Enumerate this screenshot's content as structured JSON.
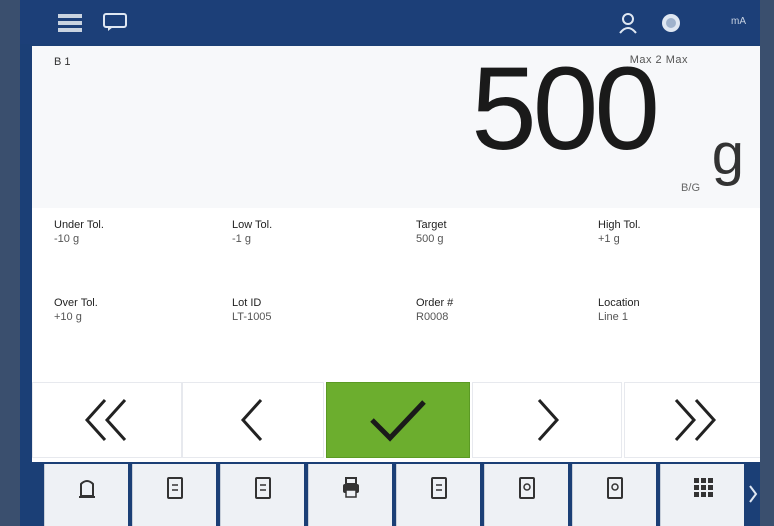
{
  "topbar": {
    "status_text": "mA"
  },
  "weigh": {
    "scale_id": "B 1",
    "scale_info": "Max 2 Max",
    "weight": "500",
    "unit": "g",
    "sub_label": "B/G"
  },
  "fields": [
    {
      "label": "Under Tol.",
      "value": "-10 g"
    },
    {
      "label": "Low Tol.",
      "value": "-1 g"
    },
    {
      "label": "Target",
      "value": "500 g"
    },
    {
      "label": "High Tol.",
      "value": "+1 g"
    },
    {
      "label": "Over Tol.",
      "value": "+10 g"
    },
    {
      "label": "Lot ID",
      "value": "LT-1005"
    },
    {
      "label": "Order #",
      "value": "R0008"
    },
    {
      "label": "Location",
      "value": "Line 1"
    }
  ],
  "nav": {
    "first": "first-icon",
    "prev": "prev-icon",
    "ok": "check-icon",
    "next": "next-icon",
    "last": "last-icon"
  },
  "fn_buttons": [
    {
      "icon": "tare-icon",
      "label": ""
    },
    {
      "icon": "doc-icon",
      "label": ""
    },
    {
      "icon": "doc-icon",
      "label": ""
    },
    {
      "icon": "print-icon",
      "label": ""
    },
    {
      "icon": "doc-icon",
      "label": ""
    },
    {
      "icon": "doc-icon",
      "label": ""
    },
    {
      "icon": "doc-icon",
      "label": ""
    },
    {
      "icon": "grid-icon",
      "label": ""
    }
  ],
  "colors": {
    "accent_green": "#6cae2e",
    "header_blue": "#1c3f78"
  }
}
